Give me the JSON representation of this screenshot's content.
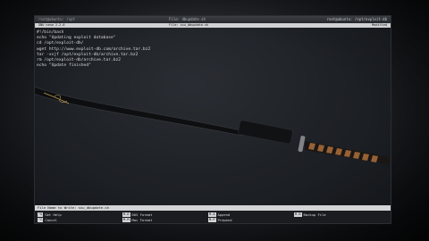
{
  "window": {
    "title_left": "root@ubuntu: /opt",
    "title_mid": "File: dbupdate.sh",
    "title_right": "root@ubuntu: /opt/exploit-db"
  },
  "nano": {
    "version": "GNU nano 2.2.6",
    "filename": "File: ssu_dbupdate.sh",
    "status": "Modified"
  },
  "script_lines": [
    "#!/bin/bash",
    "echo \"Updating exploit database\"",
    "cd /opt/exploit-db/",
    "wget http://www.exploit-db.com/archive.tar.bz2",
    "tar -xvjf /opt/exploit-db/archive.tar.bz2",
    "rm /opt/exploit-db/archive.tar.bz2",
    "echo \"Update finished\""
  ],
  "prompt_text": "File Name to Write: ssu_dbupdate.sh",
  "shortcuts": [
    {
      "key": "^G",
      "label": "Get Help"
    },
    {
      "key": "^C",
      "label": "Cancel"
    },
    {
      "key": "M-D",
      "label": "DOS Format"
    },
    {
      "key": "M-M",
      "label": "Mac Format"
    },
    {
      "key": "M-A",
      "label": "Append"
    },
    {
      "key": "M-P",
      "label": "Prepend"
    },
    {
      "key": "M-B",
      "label": "Backup File"
    }
  ]
}
